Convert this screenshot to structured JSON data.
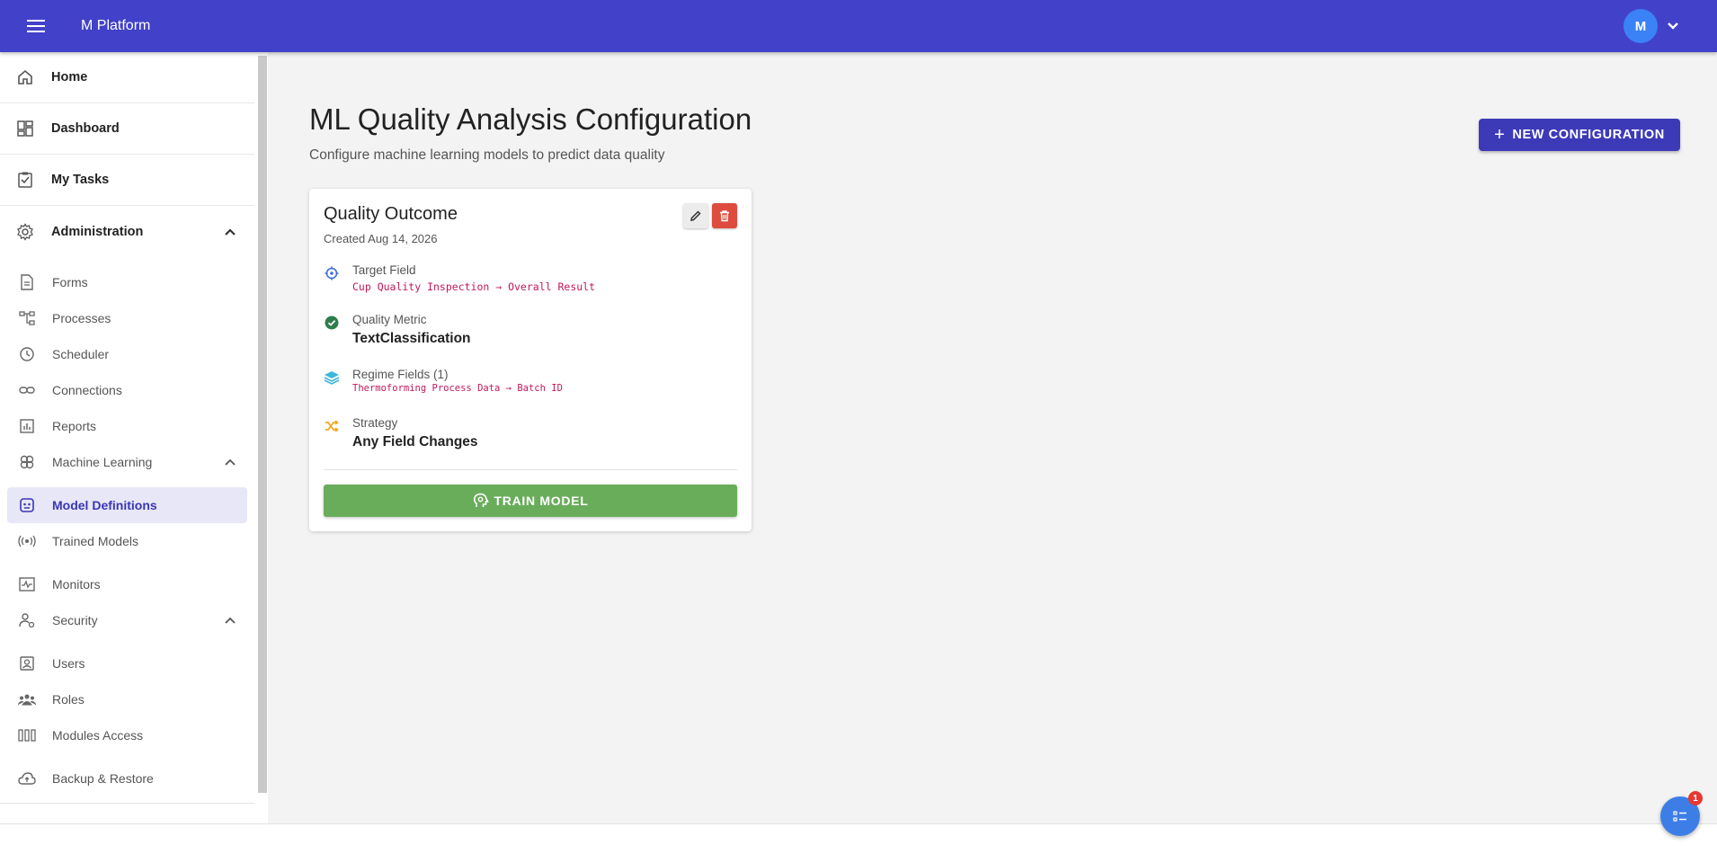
{
  "app": {
    "title": "M Platform",
    "user_initial": "M"
  },
  "sidebar": {
    "top_items": [
      {
        "label": "Home",
        "icon": "home-icon"
      },
      {
        "label": "Dashboard",
        "icon": "dashboard-icon"
      },
      {
        "label": "My Tasks",
        "icon": "tasks-icon"
      },
      {
        "label": "Administration",
        "icon": "gear-icon",
        "expanded": true
      }
    ],
    "admin_items": [
      {
        "label": "Forms",
        "icon": "form-icon"
      },
      {
        "label": "Processes",
        "icon": "process-icon"
      },
      {
        "label": "Scheduler",
        "icon": "clock-icon"
      },
      {
        "label": "Connections",
        "icon": "link-icon"
      },
      {
        "label": "Reports",
        "icon": "report-icon"
      },
      {
        "label": "Machine Learning",
        "icon": "brain-icon",
        "expanded": true
      }
    ],
    "ml_items": [
      {
        "label": "Model Definitions",
        "icon": "model-icon",
        "active": true
      },
      {
        "label": "Trained Models",
        "icon": "broadcast-icon"
      },
      {
        "label": "Monitors",
        "icon": "monitor-icon"
      },
      {
        "label": "Security",
        "icon": "security-icon",
        "expanded": true
      }
    ],
    "security_items": [
      {
        "label": "Users",
        "icon": "user-icon"
      },
      {
        "label": "Roles",
        "icon": "group-icon"
      },
      {
        "label": "Modules Access",
        "icon": "modules-icon"
      },
      {
        "label": "Backup & Restore",
        "icon": "cloud-icon"
      }
    ]
  },
  "main": {
    "title": "ML Quality Analysis Configuration",
    "subtitle": "Configure machine learning models to predict data quality",
    "new_button": "NEW CONFIGURATION",
    "card": {
      "title": "Quality Outcome",
      "created": "Created Aug 14, 2026",
      "target_label": "Target Field",
      "target_value": "Cup Quality Inspection → Overall Result",
      "metric_label": "Quality Metric",
      "metric_value": "TextClassification",
      "regime_label": "Regime Fields (1)",
      "regime_value": "Thermoforming Process Data → Batch ID",
      "strategy_label": "Strategy",
      "strategy_value": "Any Field Changes",
      "train_button": "TRAIN MODEL"
    }
  },
  "fab": {
    "badge": "1"
  },
  "colors": {
    "topbar": "#4241c9",
    "accent": "#3d3ab8",
    "train": "#69ad5b",
    "delete": "#dd4c3f",
    "mono": "#c2185b"
  }
}
